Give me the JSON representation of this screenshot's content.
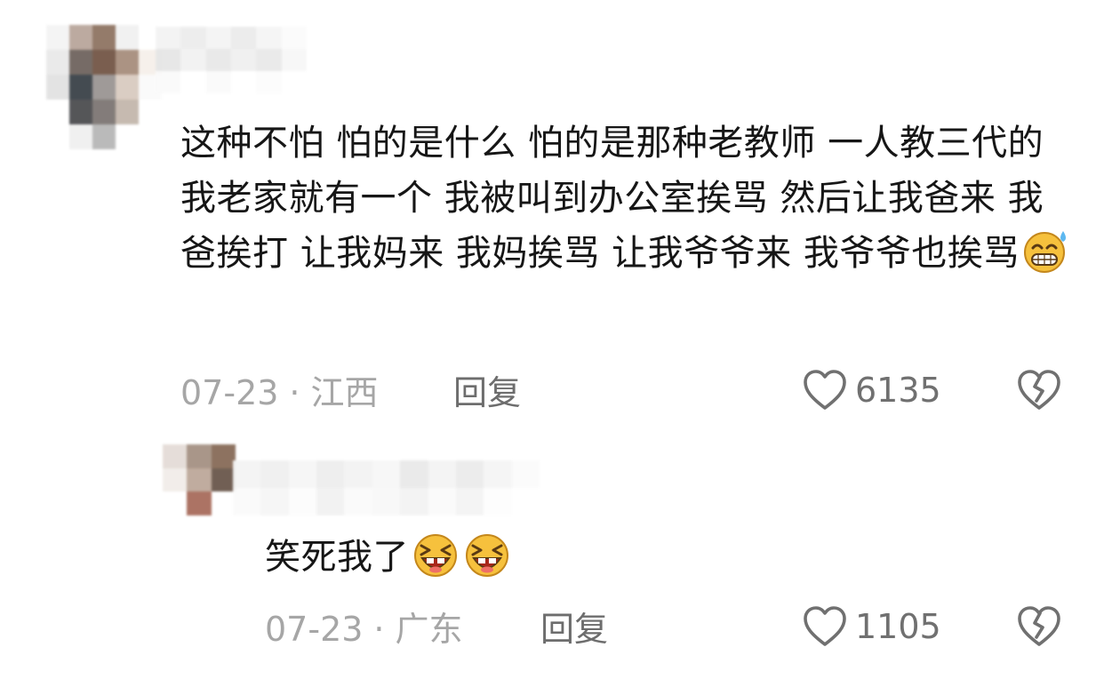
{
  "comments": [
    {
      "text": "这种不怕 怕的是什么 怕的是那种老教师 一人教三代的 我老家就有一个 我被叫到办公室挨骂 然后让我爸来 我爸挨打 让我妈来 我妈挨骂 让我爷爷来 我爷爷也挨骂",
      "emoji": "sweat-grin-emoji",
      "date": "07-23",
      "separator": "·",
      "location": "江西",
      "reply_label": "回复",
      "like_icon": "heart-outline-icon",
      "like_count": "6135",
      "dislike_icon": "broken-heart-outline-icon"
    },
    {
      "text": "笑死我了",
      "emoji": "laughing-tears-emoji",
      "emoji_repeat": 2,
      "date": "07-23",
      "separator": "·",
      "location": "广东",
      "reply_label": "回复",
      "like_icon": "heart-outline-icon",
      "like_count": "1105",
      "dislike_icon": "broken-heart-outline-icon"
    }
  ],
  "colors": {
    "text": "#161616",
    "meta": "#a6a6a6",
    "reply": "#6d6d6d",
    "icon": "#707070",
    "emoji_face": "#f6c13d"
  }
}
